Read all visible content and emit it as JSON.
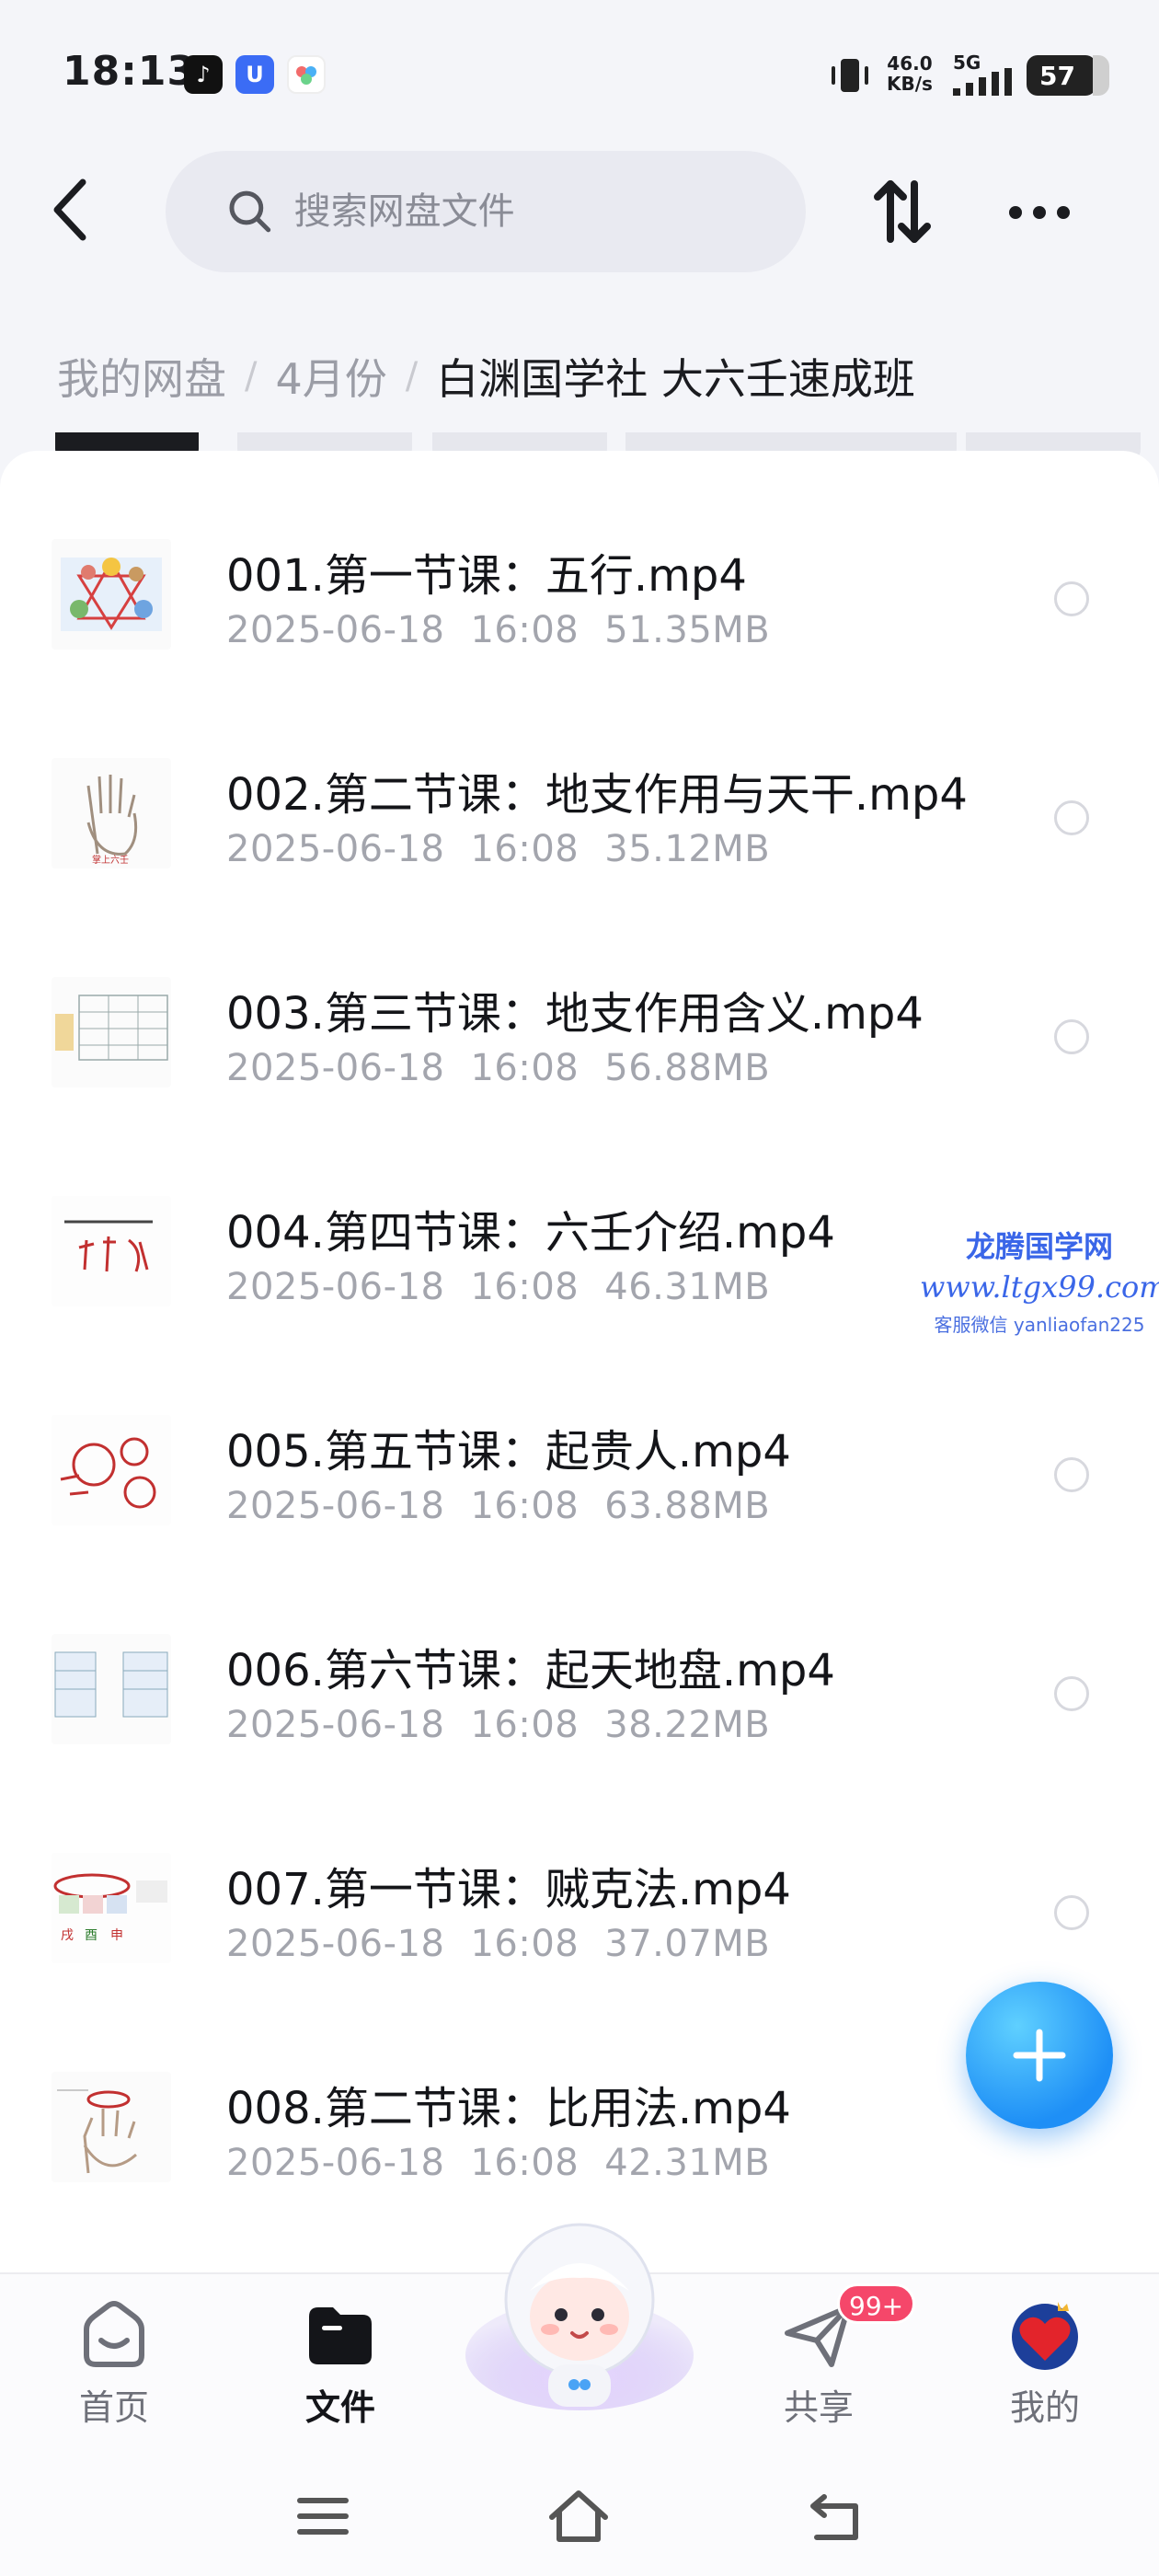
{
  "status_bar": {
    "time": "18:13",
    "net_speed_value": "46.0",
    "net_speed_unit": "KB/s",
    "network_type": "5G",
    "battery": "57"
  },
  "search": {
    "placeholder": "搜索网盘文件"
  },
  "breadcrumb": {
    "items": [
      "我的网盘",
      "4月份"
    ],
    "current": "白渊国学社  大六壬速成班"
  },
  "files": [
    {
      "name": "001.第一节课：五行.mp4",
      "date": "2025-06-18",
      "time": "16:08",
      "size": "51.35MB"
    },
    {
      "name": "002.第二节课：地支作用与天干.mp4",
      "date": "2025-06-18",
      "time": "16:08",
      "size": "35.12MB"
    },
    {
      "name": "003.第三节课：地支作用含义.mp4",
      "date": "2025-06-18",
      "time": "16:08",
      "size": "56.88MB"
    },
    {
      "name": "004.第四节课：六壬介绍.mp4",
      "date": "2025-06-18",
      "time": "16:08",
      "size": "46.31MB"
    },
    {
      "name": "005.第五节课：起贵人.mp4",
      "date": "2025-06-18",
      "time": "16:08",
      "size": "63.88MB"
    },
    {
      "name": "006.第六节课：起天地盘.mp4",
      "date": "2025-06-18",
      "time": "16:08",
      "size": "38.22MB"
    },
    {
      "name": "007.第一节课：贼克法.mp4",
      "date": "2025-06-18",
      "time": "16:08",
      "size": "37.07MB"
    },
    {
      "name": "008.第二节课：比用法.mp4",
      "date": "2025-06-18",
      "time": "16:08",
      "size": "42.31MB"
    }
  ],
  "watermark": {
    "title": "龙腾国学网",
    "url": "www.ltgx99.com",
    "contact": "客服微信 yanliaofan225"
  },
  "bottom_nav": {
    "home": "首页",
    "files": "文件",
    "share": "共享",
    "share_badge": "99+",
    "mine": "我的"
  },
  "colors": {
    "accent": "#1e8ff6",
    "badge": "#f5476a",
    "text_primary": "#141519",
    "text_secondary": "#a3a5ad"
  },
  "icons": [
    "back-arrow",
    "search",
    "sort",
    "more",
    "plus",
    "home",
    "folder",
    "send",
    "avatar-heart",
    "menu",
    "home-outline",
    "back"
  ]
}
